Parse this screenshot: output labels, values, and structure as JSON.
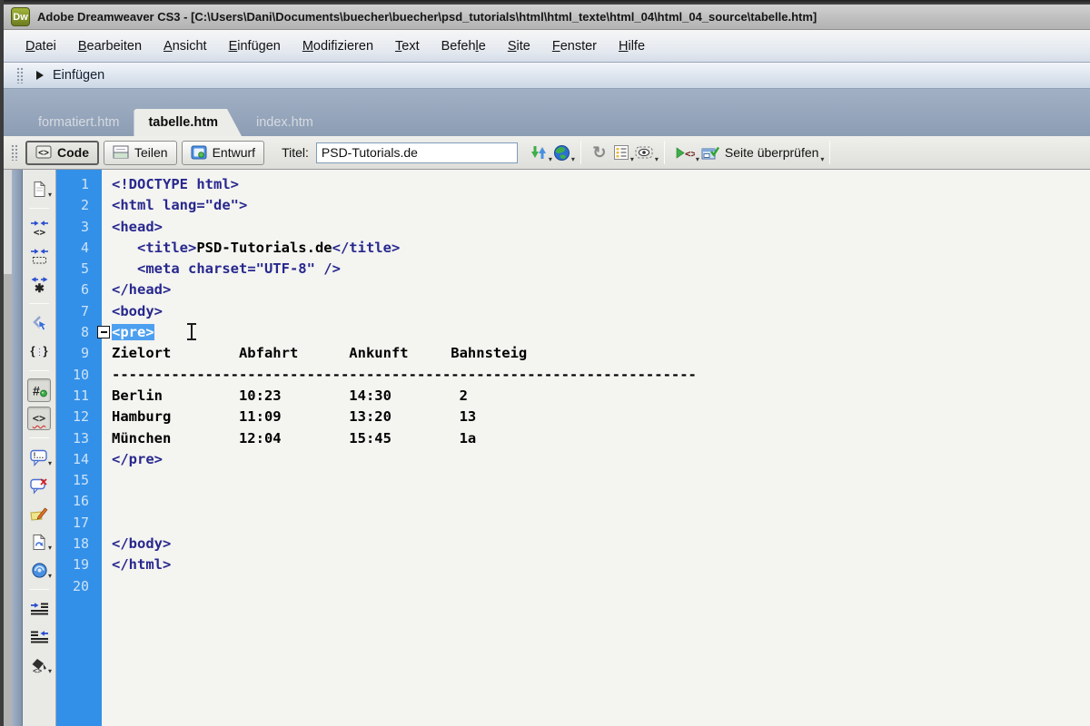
{
  "window": {
    "app_icon": "Dw",
    "title": "Adobe Dreamweaver CS3 - [C:\\Users\\Dani\\Documents\\buecher\\buecher\\psd_tutorials\\html\\html_texte\\html_04\\html_04_source\\tabelle.htm]"
  },
  "menu": {
    "items": [
      {
        "label": "Datei",
        "u": 0
      },
      {
        "label": "Bearbeiten",
        "u": 0
      },
      {
        "label": "Ansicht",
        "u": 0
      },
      {
        "label": "Einfügen",
        "u": 0
      },
      {
        "label": "Modifizieren",
        "u": 0
      },
      {
        "label": "Text",
        "u": 0
      },
      {
        "label": "Befehle",
        "u": 5
      },
      {
        "label": "Site",
        "u": 0
      },
      {
        "label": "Fenster",
        "u": 0
      },
      {
        "label": "Hilfe",
        "u": 0
      }
    ]
  },
  "insert_bar": {
    "label": "Einfügen"
  },
  "tabs": [
    {
      "label": "formatiert.htm",
      "active": false
    },
    {
      "label": "tabelle.htm",
      "active": true
    },
    {
      "label": "index.htm",
      "active": false
    }
  ],
  "toolbar": {
    "view_buttons": [
      {
        "label": "Code",
        "icon": "code-view-icon",
        "active": true
      },
      {
        "label": "Teilen",
        "icon": "split-view-icon",
        "active": false
      },
      {
        "label": "Entwurf",
        "icon": "design-view-icon",
        "active": false
      }
    ],
    "title_label": "Titel:",
    "title_value": "PSD-Tutorials.de",
    "icon_groups": [
      [
        {
          "name": "file-management-icon",
          "dropdown": true
        },
        {
          "name": "preview-browser-icon",
          "dropdown": true
        }
      ],
      [
        {
          "name": "refresh-icon",
          "dropdown": false
        },
        {
          "name": "view-options-icon",
          "dropdown": true
        },
        {
          "name": "visual-aids-icon",
          "dropdown": true
        }
      ],
      [
        {
          "name": "validate-markup-icon",
          "dropdown": true
        },
        {
          "name": "check-page-icon",
          "dropdown": true,
          "label": "Seite überprüfen"
        }
      ]
    ]
  },
  "coding_toolbar": {
    "groups": [
      [
        {
          "name": "open-documents-icon",
          "dropdown": true
        }
      ],
      [
        {
          "name": "collapse-full-tag-icon"
        },
        {
          "name": "collapse-selection-icon"
        },
        {
          "name": "expand-all-icon"
        }
      ],
      [
        {
          "name": "select-parent-tag-icon"
        },
        {
          "name": "balance-braces-icon"
        }
      ],
      [
        {
          "name": "line-numbers-icon",
          "active": true
        },
        {
          "name": "highlight-invalid-code-icon",
          "active": true
        }
      ],
      [
        {
          "name": "apply-comment-icon",
          "dropdown": true
        },
        {
          "name": "remove-comment-icon"
        },
        {
          "name": "wrap-tag-icon"
        },
        {
          "name": "recent-snippets-icon",
          "dropdown": true
        },
        {
          "name": "move-css-icon",
          "dropdown": true
        }
      ],
      [
        {
          "name": "indent-code-icon"
        },
        {
          "name": "outdent-code-icon"
        },
        {
          "name": "format-source-code-icon",
          "dropdown": true
        }
      ]
    ]
  },
  "editor": {
    "lines": [
      {
        "n": 1,
        "seg": [
          {
            "t": "tag",
            "x": "<!DOCTYPE html>"
          }
        ]
      },
      {
        "n": 2,
        "seg": [
          {
            "t": "tag",
            "x": "<html lang=\"de\">"
          }
        ]
      },
      {
        "n": 3,
        "seg": [
          {
            "t": "tag",
            "x": "<head>"
          }
        ]
      },
      {
        "n": 4,
        "seg": [
          {
            "t": "plain",
            "x": "   "
          },
          {
            "t": "tag",
            "x": "<title>"
          },
          {
            "t": "plain",
            "x": "PSD-Tutorials.de"
          },
          {
            "t": "tag",
            "x": "</title>"
          }
        ]
      },
      {
        "n": 5,
        "seg": [
          {
            "t": "plain",
            "x": "   "
          },
          {
            "t": "tag",
            "x": "<meta charset=\"UTF-8\" />"
          }
        ]
      },
      {
        "n": 6,
        "seg": [
          {
            "t": "tag",
            "x": "</head>"
          }
        ]
      },
      {
        "n": 7,
        "seg": [
          {
            "t": "tag",
            "x": "<body>"
          }
        ]
      },
      {
        "n": 8,
        "collapse": true,
        "seg": [
          {
            "t": "sel",
            "x": "<pre>"
          }
        ]
      },
      {
        "n": 9,
        "seg": [
          {
            "t": "plain",
            "x": "Zielort        Abfahrt      Ankunft     Bahnsteig"
          }
        ]
      },
      {
        "n": 10,
        "seg": [
          {
            "t": "plain",
            "x": "---------------------------------------------------------------------"
          }
        ]
      },
      {
        "n": 11,
        "seg": [
          {
            "t": "plain",
            "x": "Berlin         10:23        14:30        2"
          }
        ]
      },
      {
        "n": 12,
        "seg": [
          {
            "t": "plain",
            "x": "Hamburg        11:09        13:20        13"
          }
        ]
      },
      {
        "n": 13,
        "seg": [
          {
            "t": "plain",
            "x": "München        12:04        15:45        1a"
          }
        ]
      },
      {
        "n": 14,
        "seg": [
          {
            "t": "tag",
            "x": "</pre>"
          }
        ]
      },
      {
        "n": 15,
        "seg": []
      },
      {
        "n": 16,
        "seg": []
      },
      {
        "n": 17,
        "seg": []
      },
      {
        "n": 18,
        "seg": [
          {
            "t": "tag",
            "x": "</body>"
          }
        ]
      },
      {
        "n": 19,
        "seg": [
          {
            "t": "tag",
            "x": "</html>"
          }
        ]
      },
      {
        "n": 20,
        "seg": []
      }
    ]
  },
  "colors": {
    "gutter_blue": "#3390e8",
    "selection_blue": "#4da0f0",
    "tag_navy": "#28288e",
    "header_gray_blue": "#8c9db4"
  }
}
